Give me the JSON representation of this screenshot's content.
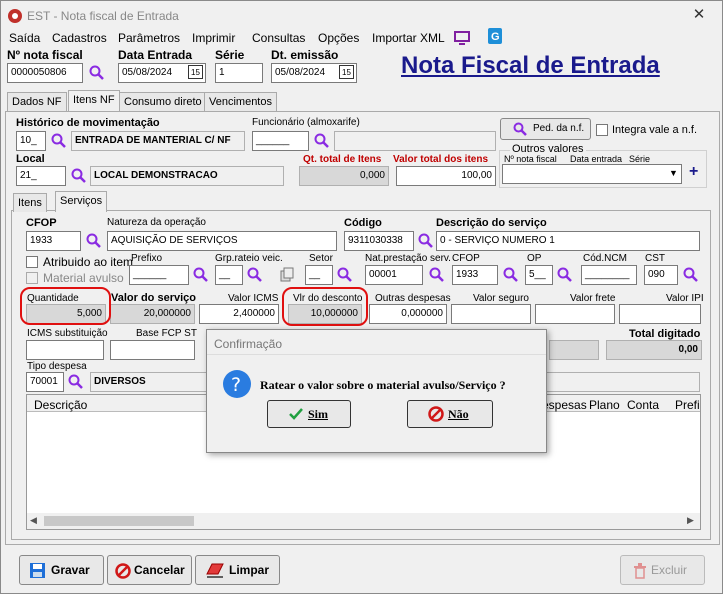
{
  "window": {
    "title": "EST - Nota fiscal de Entrada",
    "close": "✕"
  },
  "menu": [
    "Saída",
    "Cadastros",
    "Parâmetros",
    "Imprimir",
    "Consultas",
    "Opções",
    "Importar XML"
  ],
  "header": {
    "nf_label": "Nº nota fiscal",
    "nf_value": "0000050806",
    "data_entrada_label": "Data Entrada",
    "data_entrada_value": "05/08/2024",
    "cal1": "15",
    "serie_label": "Série",
    "serie_value": "1",
    "dt_emissao_label": "Dt. emissão",
    "dt_emissao_value": "05/08/2024",
    "cal2": "15",
    "big_title": "Nota Fiscal de Entrada"
  },
  "tabs": [
    "Dados NF",
    "Itens NF",
    "Consumo direto",
    "Vencimentos"
  ],
  "itens": {
    "historico_label": "Histórico de movimentação",
    "historico_code": "10_",
    "historico_desc": "ENTRADA DE MANTERIAL C/ NF",
    "funcionario_label": "Funcionário (almoxarife)",
    "funcionario_code": "______",
    "ped_btn": "Ped. da n.f.",
    "integra_label": "Integra vale a n.f.",
    "local_label": "Local",
    "local_code": "21_",
    "local_desc": "LOCAL DEMONSTRACAO",
    "qt_total_label": "Qt. total de Itens",
    "qt_total_value": "0,000",
    "valor_total_label": "Valor total dos itens",
    "valor_total_value": "100,00",
    "outros_valores_label": "Outros valores",
    "ov_cols": [
      "Nº nota fiscal",
      "Data entrada",
      "Série"
    ],
    "plus": "+"
  },
  "subtabs": [
    "Itens",
    "Serviços"
  ],
  "servicos": {
    "cfop_label": "CFOP",
    "cfop_value": "1933",
    "natureza_label": "Natureza da operação",
    "natureza_value": "AQUISIÇÃO DE SERVIÇOS",
    "codigo_label": "Código",
    "codigo_value": "9311030338",
    "descricao_label": "Descrição do serviço",
    "descricao_value": "0 - SERVIÇO NUMERO 1",
    "atribuido_label": "Atribuido ao item",
    "material_label": "Material avulso",
    "prefixo_label": "Prefixo",
    "prefixo_value": "______",
    "grp_label": "Grp.rateio veic.",
    "grp_value": "__",
    "setor_label": "Setor",
    "setor_value": "__",
    "natprest_label": "Nat.prestação serv.",
    "natprest_value": "00001",
    "cfop2_label": "CFOP",
    "cfop2_value": "1933",
    "op_label": "OP",
    "op_value": "5__",
    "ncm_label": "Cód.NCM",
    "ncm_value": "________",
    "cst_label": "CST",
    "cst_value": "090",
    "quantidade_label": "Quantidade",
    "quantidade_value": "5,000",
    "valor_servico_label": "Valor do serviço",
    "valor_servico_value": "20,000000",
    "valor_icms_label": "Valor ICMS",
    "valor_icms_value": "2,400000",
    "vlr_desconto_label": "Vlr do desconto",
    "vlr_desconto_value": "10,000000",
    "outras_desp_label": "Outras despesas",
    "outras_desp_value": "0,000000",
    "valor_seguro_label": "Valor seguro",
    "valor_frete_label": "Valor frete",
    "valor_ipi_label": "Valor IPI",
    "icms_sub_label": "ICMS substituição",
    "base_fcp_label": "Base FCP ST",
    "total_digitado_label": "Total digitado",
    "total_digitado_value": "0,00",
    "tipo_despesa_label": "Tipo despesa",
    "tipo_despesa_code": "70001",
    "tipo_despesa_desc": "DIVERSOS",
    "grid_cols": [
      "Descrição",
      "espesas",
      "Plano",
      "Conta",
      "Prefi"
    ]
  },
  "dialog": {
    "title": "Confirmação",
    "message": "Ratear o valor sobre o material avulso/Serviço ?",
    "yes": "Sim",
    "no": "Não"
  },
  "footer": {
    "gravar": "Gravar",
    "cancelar": "Cancelar",
    "limpar": "Limpar",
    "excluir": "Excluir"
  }
}
